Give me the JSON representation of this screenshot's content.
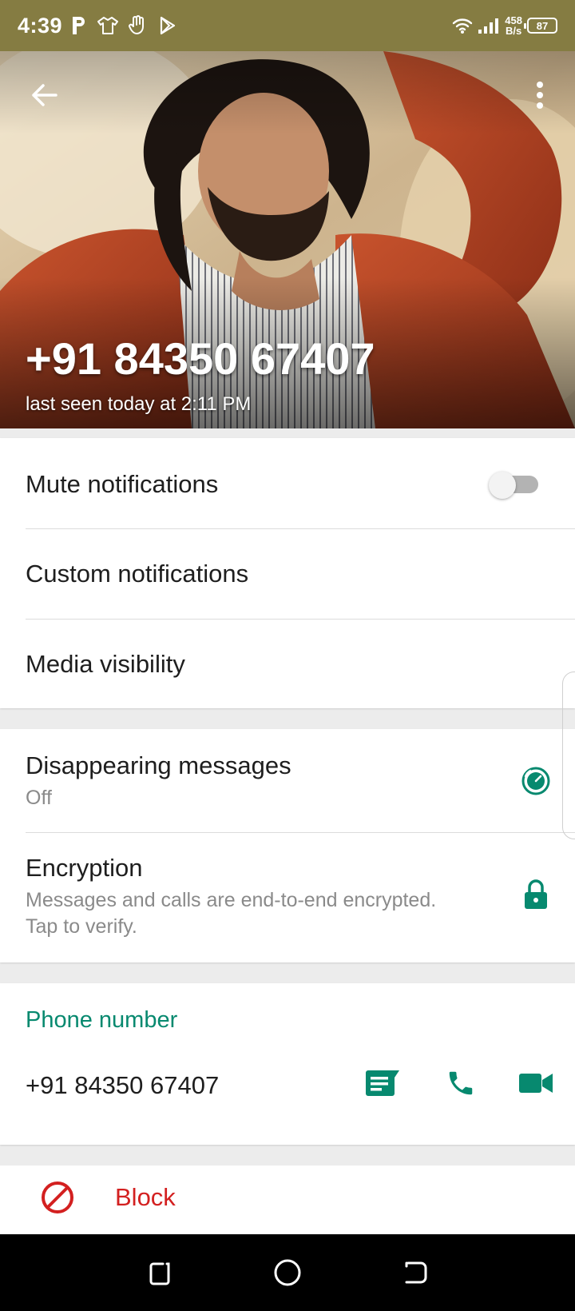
{
  "status_bar": {
    "time": "4:39",
    "net_speed_value": "458",
    "net_speed_unit": "B/s",
    "battery": "87",
    "left_icons": [
      "p-icon",
      "tshirt-icon",
      "hand-icon",
      "play-store-icon"
    ],
    "right_icons": [
      "wifi-icon",
      "signal-icon"
    ]
  },
  "header": {
    "title": "+91 84350 67407",
    "subtitle": "last seen today at 2:11 PM",
    "back_icon": "back-arrow-icon",
    "menu_icon": "more-vert-icon"
  },
  "settings": {
    "mute": {
      "label": "Mute notifications",
      "enabled": false
    },
    "custom_notifications": {
      "label": "Custom notifications"
    },
    "media_visibility": {
      "label": "Media visibility"
    },
    "disappearing": {
      "label": "Disappearing messages",
      "value": "Off",
      "icon": "timer-icon"
    },
    "encryption": {
      "label": "Encryption",
      "line1": "Messages and calls are end-to-end encrypted.",
      "line2": "Tap to verify.",
      "icon": "lock-icon"
    }
  },
  "phone": {
    "section_label": "Phone number",
    "number": "+91 84350 67407",
    "actions": [
      "message-icon",
      "call-icon",
      "video-call-icon"
    ]
  },
  "block": {
    "label": "Block",
    "icon": "block-icon"
  },
  "nav": [
    "recents-icon",
    "home-icon",
    "back-icon"
  ],
  "colors": {
    "status_bar": "#857c42",
    "accent": "#07896f",
    "danger": "#d32020"
  }
}
